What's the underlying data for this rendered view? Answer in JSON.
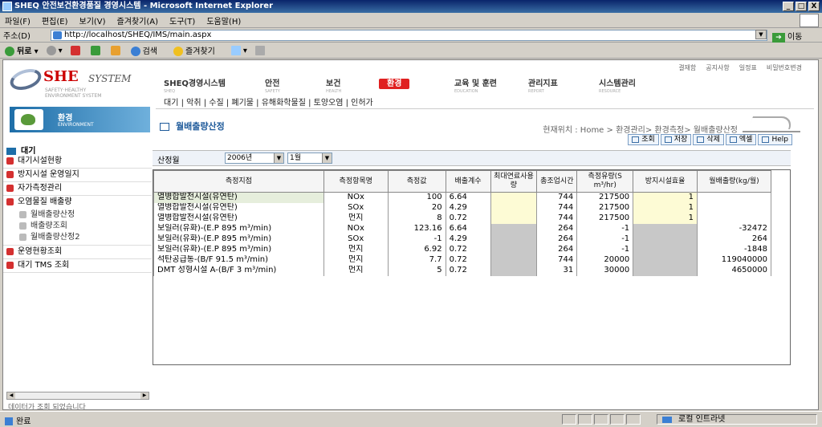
{
  "window": {
    "title": "SHEQ 안전보건환경품질 경영시스템 - Microsoft Internet Explorer",
    "controls": [
      "_",
      "□",
      "X"
    ]
  },
  "menu": [
    "파일(F)",
    "편집(E)",
    "보기(V)",
    "즐겨찾기(A)",
    "도구(T)",
    "도움말(H)"
  ],
  "address": {
    "label": "주소(D)",
    "url": "http://localhost/SHEQ/IMS/main.aspx",
    "go": "이동"
  },
  "toolbar": {
    "back": "뒤로",
    "search": "검색",
    "favorites": "즐겨찾기"
  },
  "top_links": [
    "결재함",
    "공지사항",
    "일정표",
    "비밀번호변경"
  ],
  "logo": {
    "brand": "SHE",
    "system": "SYSTEM",
    "tagline": "SAFETY·HEALTHY ENVIRONMENT SYSTEM"
  },
  "top_nav": [
    {
      "label": "SHEQ경영시스템",
      "sub": "SHEQ"
    },
    {
      "label": "안전",
      "sub": "SAFETY"
    },
    {
      "label": "보건",
      "sub": "HEALTH"
    },
    {
      "label": "환경",
      "sub": ""
    },
    {
      "label": "교육 및 훈련",
      "sub": "EDUCATION"
    },
    {
      "label": "관리지표",
      "sub": "REPORT"
    },
    {
      "label": "시스템관리",
      "sub": "RESOURCE"
    }
  ],
  "sub_nav": "대기 | 악취 | 수질 | 폐기물 | 유해화학물질 | 토양오염 | 인허가",
  "left_category": {
    "title": "환경",
    "subtitle": "ENVIRONMENT"
  },
  "left_header": "대기",
  "left_menu": {
    "m1": "대기시설현황",
    "m2": "방지시설 운영일지",
    "m3": "자가측정관리",
    "m4": "오염물질 배출량",
    "s1": "월배출량산정",
    "s2": "배출량조회",
    "s3": "월배출량산정2",
    "m5": "운영현황조회",
    "m6": "대기 TMS 조회"
  },
  "left_status": "데이터가 조회 되었습니다",
  "page_title": "월배출량산정",
  "location": "현재위치 : Home > 환경관리> 환경측정> 월배출량산정",
  "buttons": {
    "search": "조회",
    "save": "저장",
    "delete": "삭제",
    "excel": "엑셀",
    "help": "Help"
  },
  "condition": {
    "label": "산정월",
    "year": "2006년",
    "month": "1월"
  },
  "table_headers": [
    "측정지점",
    "측정항목명",
    "측정값",
    "배출계수",
    "최대연료사용량",
    "총조업시간",
    "측정유량(S m³/hr)",
    "방지시설효율",
    "월배출량(kg/월)"
  ],
  "rows": [
    {
      "site": "열병합발전시설(유연탄)",
      "item": "NOx",
      "value": "100",
      "coef": "6.64",
      "fuel": "",
      "hours": "744",
      "flow": "217500",
      "eff": "1",
      "monthly": ""
    },
    {
      "site": "열병합발전시설(유연탄)",
      "item": "SOx",
      "value": "20",
      "coef": "4.29",
      "fuel": "",
      "hours": "744",
      "flow": "217500",
      "eff": "1",
      "monthly": ""
    },
    {
      "site": "열병합발전시설(유연탄)",
      "item": "먼지",
      "value": "8",
      "coef": "0.72",
      "fuel": "",
      "hours": "744",
      "flow": "217500",
      "eff": "1",
      "monthly": ""
    },
    {
      "site": "보일러(유화)-(E.P 895 m³/min)",
      "item": "NOx",
      "value": "123.16",
      "coef": "6.64",
      "fuel": "",
      "hours": "264",
      "flow": "-1",
      "eff": "",
      "monthly": "-32472"
    },
    {
      "site": "보일러(유화)-(E.P 895 m³/min)",
      "item": "SOx",
      "value": "-1",
      "coef": "4.29",
      "fuel": "",
      "hours": "264",
      "flow": "-1",
      "eff": "",
      "monthly": "264"
    },
    {
      "site": "보일러(유화)-(E.P 895 m³/min)",
      "item": "먼지",
      "value": "6.92",
      "coef": "0.72",
      "fuel": "",
      "hours": "264",
      "flow": "-1",
      "eff": "",
      "monthly": "-1848"
    },
    {
      "site": "석탄공급통-(B/F 91.5 m³/min)",
      "item": "먼지",
      "value": "7.7",
      "coef": "0.72",
      "fuel": "",
      "hours": "744",
      "flow": "20000",
      "eff": "",
      "monthly": "119040000"
    },
    {
      "site": "DMT 성형시설 A-(B/F 3 m³/min)",
      "item": "먼지",
      "value": "5",
      "coef": "0.72",
      "fuel": "",
      "hours": "31",
      "flow": "30000",
      "eff": "",
      "monthly": "4650000"
    }
  ],
  "status": {
    "text": "완료",
    "zone": "로컬 인트라넷"
  }
}
